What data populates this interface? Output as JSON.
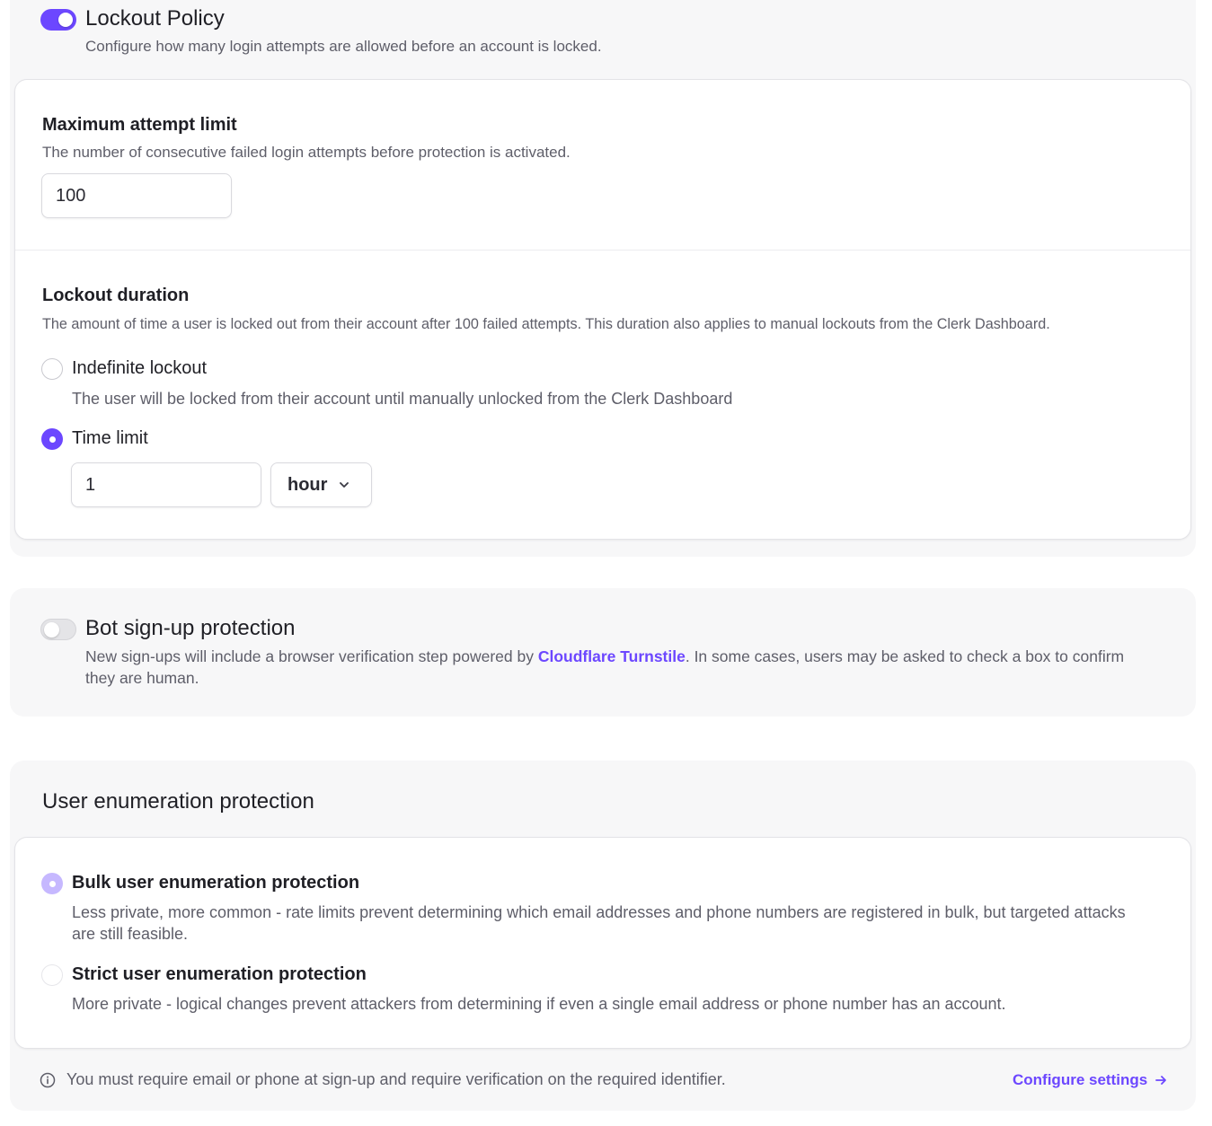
{
  "lockout": {
    "enabled": true,
    "title": "Lockout Policy",
    "description": "Configure how many login attempts are allowed before an account is locked.",
    "max_attempts": {
      "title": "Maximum attempt limit",
      "description": "The number of consecutive failed login attempts before protection is activated.",
      "value": "100"
    },
    "duration": {
      "title": "Lockout duration",
      "description": "The amount of time a user is locked out from their account after 100 failed attempts. This duration also applies to manual lockouts from the Clerk Dashboard.",
      "options": [
        {
          "label": "Indefinite lockout",
          "description": "The user will be locked from their account until manually unlocked from the Clerk Dashboard",
          "selected": false
        },
        {
          "label": "Time limit",
          "selected": true
        }
      ],
      "time_value": "1",
      "time_unit": "hour"
    }
  },
  "bot_protection": {
    "enabled": false,
    "title": "Bot sign-up protection",
    "description_before": "New sign-ups will include a browser verification step powered by ",
    "link_text": "Cloudflare Turnstile",
    "description_after": ". In some cases, users may be asked to check a box to confirm they are human."
  },
  "enumeration": {
    "title": "User enumeration protection",
    "options": [
      {
        "label": "Bulk user enumeration protection",
        "description": "Less private, more common - rate limits prevent determining which email addresses and phone numbers are registered in bulk, but targeted attacks are still feasible.",
        "selected": true
      },
      {
        "label": "Strict user enumeration protection",
        "description": "More private - logical changes prevent attackers from determining if even a single email address or phone number has an account.",
        "selected": false
      }
    ],
    "note": "You must require email or phone at sign-up and require verification on the required identifier.",
    "configure_link": "Configure settings"
  },
  "colors": {
    "accent": "#6c47ff",
    "accent_disabled": "#c6b8ff",
    "section_bg": "#f7f7f8"
  }
}
